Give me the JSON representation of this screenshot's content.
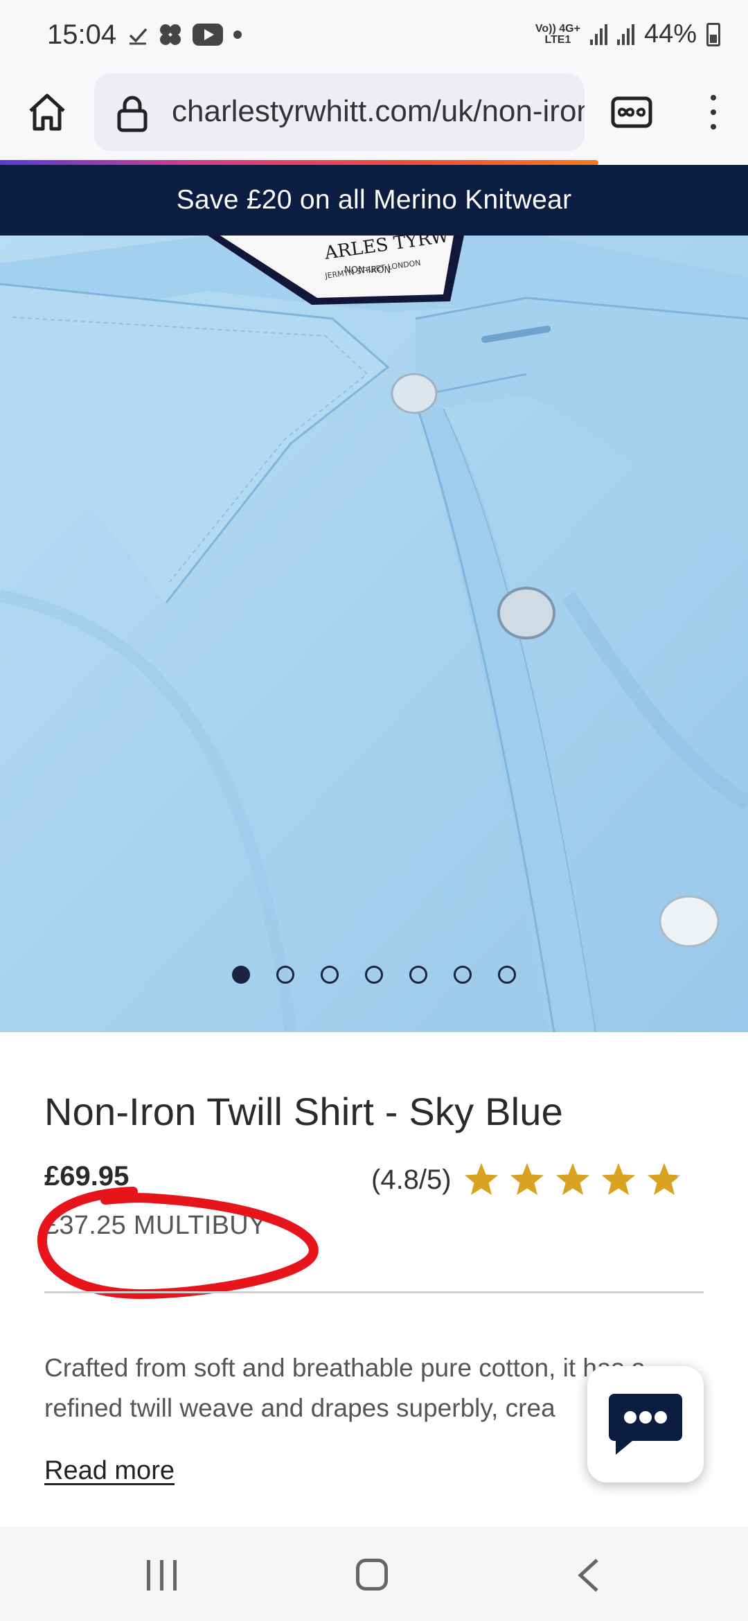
{
  "status_bar": {
    "time": "15:04",
    "network_top": "Vo)) 4G+",
    "network_bottom": "LTE1",
    "battery": "44%",
    "icons": [
      "check-icon",
      "flower-app-icon",
      "youtube-icon",
      "dot-icon",
      "signal-icon",
      "battery-icon"
    ]
  },
  "browser": {
    "url": "charlestyrwhitt.com/uk/non-iron-twill-shirt",
    "icons": [
      "home-icon",
      "lock-icon",
      "reader-mode-icon",
      "more-vert-icon"
    ],
    "load_progress": 0.8
  },
  "promo": {
    "text": "Save £20 on all Merino Knitwear"
  },
  "product_image": {
    "label_line1": "ARLES TYRW",
    "label_line2": "JERMYN STREET LONDON",
    "label_line3": "NON-IRON",
    "slide_count": 7,
    "active_slide": 1
  },
  "product": {
    "title": "Non-Iron Twill Shirt - Sky Blue",
    "price": "£69.95",
    "multibuy": "£37.25 MULTIBUY",
    "rating_text": "(4.8/5)",
    "rating_value": 4.8,
    "rating_max": 5,
    "description": "Crafted from soft and breathable pure cotton, it has a refined twill weave and drapes superbly, crea",
    "read_more": "Read more"
  },
  "colors": {
    "promo_bg": "#0b1e42",
    "shirt": "#a9d3ef",
    "star": "#d9a321",
    "annotation": "#e8141b",
    "chat_icon": "#0b1e42"
  }
}
